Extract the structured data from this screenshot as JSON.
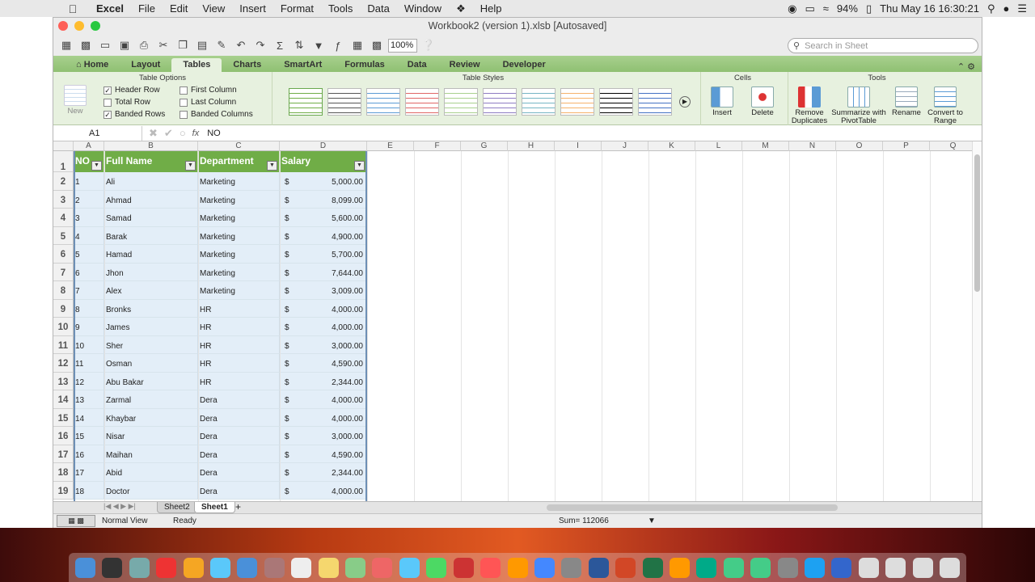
{
  "menubar": {
    "app": "Excel",
    "items": [
      "File",
      "Edit",
      "View",
      "Insert",
      "Format",
      "Tools",
      "Data",
      "Window",
      "Help"
    ],
    "battery": "94%",
    "clock": "Thu May 16  16:30:21"
  },
  "window": {
    "title": "Workbook2 (version 1).xlsb   [Autosaved]",
    "zoom": "100%",
    "search_placeholder": "Search in Sheet"
  },
  "tabs": [
    "Home",
    "Layout",
    "Tables",
    "Charts",
    "SmartArt",
    "Formulas",
    "Data",
    "Review",
    "Developer"
  ],
  "ribbon": {
    "table_options_title": "Table Options",
    "new_label": "New",
    "checks": [
      {
        "label": "Header Row",
        "checked": true
      },
      {
        "label": "Total Row",
        "checked": false
      },
      {
        "label": "Banded Rows",
        "checked": true
      },
      {
        "label": "First Column",
        "checked": false
      },
      {
        "label": "Last Column",
        "checked": false
      },
      {
        "label": "Banded Columns",
        "checked": false
      }
    ],
    "table_styles_title": "Table Styles",
    "style_colors": [
      "#70ad47",
      "#555555",
      "#5b9bd5",
      "#e06666",
      "#a9d18e",
      "#8e7cc3",
      "#76b5c5",
      "#f6b26b",
      "#000000",
      "#4472c4"
    ],
    "cells_title": "Cells",
    "insert_label": "Insert",
    "delete_label": "Delete",
    "tools_title": "Tools",
    "tools": [
      "Remove Duplicates",
      "Summarize with PivotTable",
      "Rename",
      "Convert to Range"
    ]
  },
  "formula_bar": {
    "name_box": "A1",
    "fx": "fx",
    "value": "NO"
  },
  "columns": [
    "A",
    "B",
    "C",
    "D",
    "E",
    "F",
    "G",
    "H",
    "I",
    "J",
    "K",
    "L",
    "M",
    "N",
    "O",
    "P",
    "Q"
  ],
  "table": {
    "headers": [
      "NO",
      "Full Name",
      "Department",
      "Salary"
    ],
    "currency": "$",
    "rows": [
      [
        "1",
        "Ali",
        "Marketing",
        "5,000.00"
      ],
      [
        "2",
        "Ahmad",
        "Marketing",
        "8,099.00"
      ],
      [
        "3",
        "Samad",
        "Marketing",
        "5,600.00"
      ],
      [
        "4",
        "Barak",
        "Marketing",
        "4,900.00"
      ],
      [
        "5",
        "Hamad",
        "Marketing",
        "5,700.00"
      ],
      [
        "6",
        "Jhon",
        "Marketing",
        "7,644.00"
      ],
      [
        "7",
        "Alex",
        "Marketing",
        "3,009.00"
      ],
      [
        "8",
        "Bronks",
        "HR",
        "4,000.00"
      ],
      [
        "9",
        "James",
        "HR",
        "4,000.00"
      ],
      [
        "10",
        "Sher",
        "HR",
        "3,000.00"
      ],
      [
        "11",
        "Osman",
        "HR",
        "4,590.00"
      ],
      [
        "12",
        "Abu Bakar",
        "HR",
        "2,344.00"
      ],
      [
        "13",
        "Zarmal",
        "Dera",
        "4,000.00"
      ],
      [
        "14",
        "Khaybar",
        "Dera",
        "4,000.00"
      ],
      [
        "15",
        "Nisar",
        "Dera",
        "3,000.00"
      ],
      [
        "16",
        "Maihan",
        "Dera",
        "4,590.00"
      ],
      [
        "17",
        "Abid",
        "Dera",
        "2,344.00"
      ],
      [
        "18",
        "Doctor",
        "Dera",
        "4,000.00"
      ]
    ]
  },
  "sheets": [
    "Sheet2",
    "Sheet1"
  ],
  "status": {
    "view": "Normal View",
    "ready": "Ready",
    "sum": "Sum= 112066"
  }
}
